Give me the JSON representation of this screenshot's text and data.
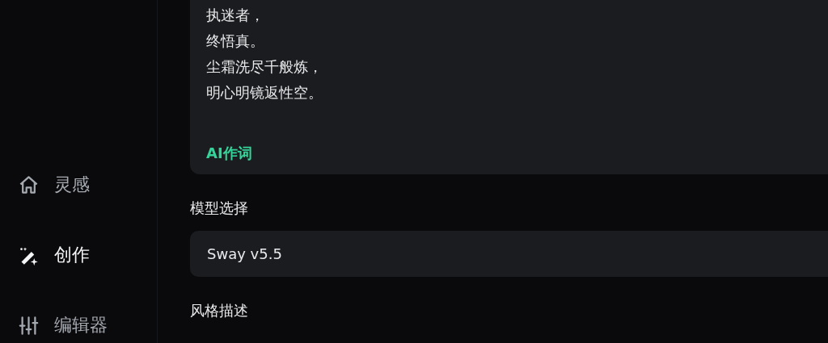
{
  "sidebar": {
    "items": [
      {
        "label": "灵感",
        "selected": false
      },
      {
        "label": "创作",
        "selected": true
      },
      {
        "label": "编辑器",
        "selected": false
      }
    ]
  },
  "lyrics": {
    "lines": [
      "执迷者，",
      "终悟真。",
      "尘霜洗尽千般炼，",
      "明心明镜返性空。"
    ],
    "action": "AI作词"
  },
  "model": {
    "label": "模型选择",
    "value": "Sway v5.5"
  },
  "style": {
    "label": "风格描述"
  }
}
